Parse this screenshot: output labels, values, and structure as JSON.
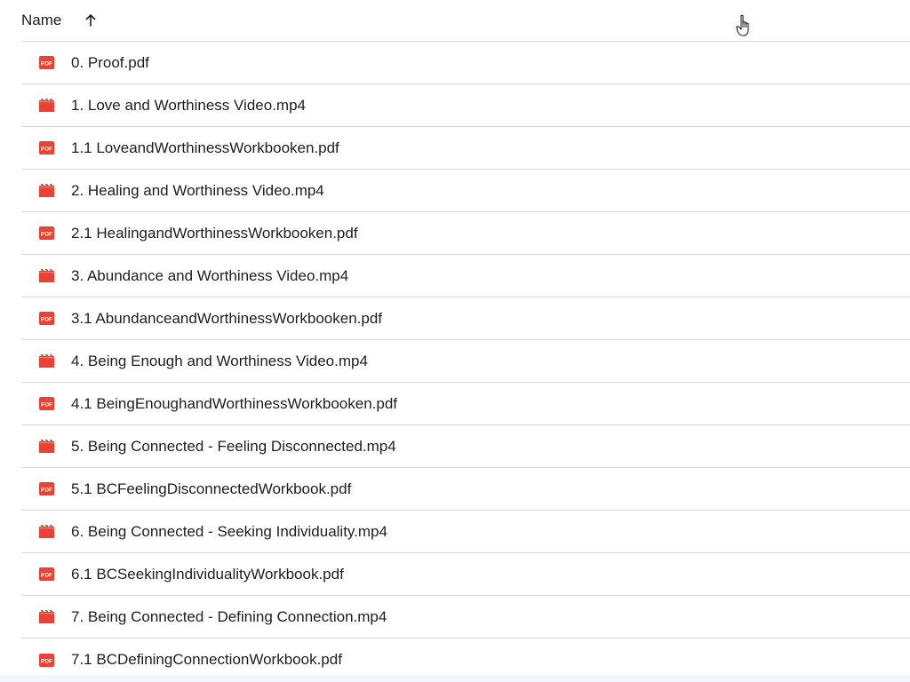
{
  "header": {
    "name_label": "Name",
    "sort_icon": "arrow-up-icon"
  },
  "files": [
    {
      "name": "0. Proof.pdf",
      "type": "pdf"
    },
    {
      "name": "1. Love and Worthiness Video.mp4",
      "type": "video"
    },
    {
      "name": "1.1 LoveandWorthinessWorkbooken.pdf",
      "type": "pdf"
    },
    {
      "name": "2. Healing and Worthiness Video.mp4",
      "type": "video"
    },
    {
      "name": "2.1 HealingandWorthinessWorkbooken.pdf",
      "type": "pdf"
    },
    {
      "name": "3. Abundance and Worthiness Video.mp4",
      "type": "video"
    },
    {
      "name": "3.1 AbundanceandWorthinessWorkbooken.pdf",
      "type": "pdf"
    },
    {
      "name": "4. Being Enough and Worthiness Video.mp4",
      "type": "video"
    },
    {
      "name": "4.1 BeingEnoughandWorthinessWorkbooken.pdf",
      "type": "pdf"
    },
    {
      "name": "5. Being Connected - Feeling Disconnected.mp4",
      "type": "video"
    },
    {
      "name": "5.1 BCFeelingDisconnectedWorkbook.pdf",
      "type": "pdf"
    },
    {
      "name": "6. Being Connected - Seeking Individuality.mp4",
      "type": "video"
    },
    {
      "name": "6.1 BCSeekingIndividualityWorkbook.pdf",
      "type": "pdf"
    },
    {
      "name": "7. Being Connected - Defining Connection.mp4",
      "type": "video"
    },
    {
      "name": "7.1 BCDefiningConnectionWorkbook.pdf",
      "type": "pdf"
    }
  ],
  "colors": {
    "pdf_icon": "#ea4335",
    "video_icon": "#ea4335",
    "divider": "#d9d9d9",
    "text": "#1f1f1f"
  }
}
